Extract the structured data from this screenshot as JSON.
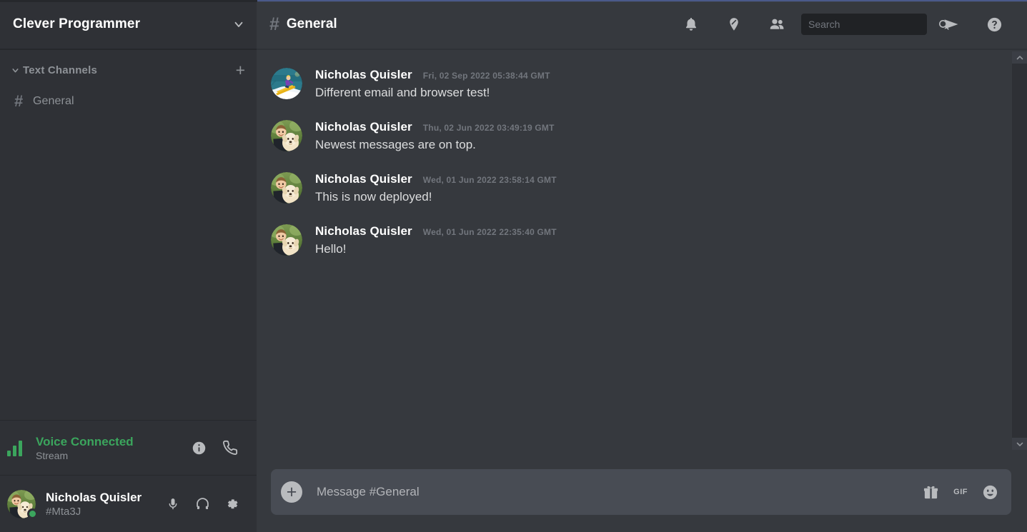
{
  "sidebar": {
    "guild_name": "Clever Programmer",
    "guild_chevron_icon": "chevron-down-icon",
    "category": {
      "label": "Text Channels",
      "chevron_icon": "chevron-down-icon",
      "add_label": "+"
    },
    "channels": [
      {
        "hash": "#",
        "name": "General",
        "active": false
      }
    ],
    "voice": {
      "status": "Voice Connected",
      "subtitle": "Stream",
      "signal_icon": "signal-bars-icon",
      "info_icon": "info-icon",
      "disconnect_icon": "phone-icon",
      "accent_color": "#3ba55d"
    },
    "user": {
      "name": "Nicholas Quisler",
      "tag": "#Mta3J",
      "status": "online",
      "status_color": "#3ba55d",
      "mic_icon": "microphone-icon",
      "headphones_icon": "headphones-icon",
      "settings_icon": "gear-icon"
    }
  },
  "header": {
    "hash": "#",
    "channel_title": "General",
    "icons": [
      {
        "name": "bell-icon"
      },
      {
        "name": "pin-icon"
      },
      {
        "name": "members-icon"
      }
    ],
    "search": {
      "placeholder": "Search",
      "value": "",
      "icon": "search-icon"
    },
    "inbox_icon": "send-icon",
    "help_icon": "help-icon"
  },
  "messages": [
    {
      "author": "Nicholas Quisler",
      "timestamp": "Fri, 02 Sep 2022 05:38:44 GMT",
      "text": "Different email and browser test!",
      "avatar": "ski"
    },
    {
      "author": "Nicholas Quisler",
      "timestamp": "Thu, 02 Jun 2022 03:49:19 GMT",
      "text": "Newest messages are on top.",
      "avatar": "photo"
    },
    {
      "author": "Nicholas Quisler",
      "timestamp": "Wed, 01 Jun 2022 23:58:14 GMT",
      "text": "This is now deployed!",
      "avatar": "photo"
    },
    {
      "author": "Nicholas Quisler",
      "timestamp": "Wed, 01 Jun 2022 22:35:40 GMT",
      "text": "Hello!",
      "avatar": "photo"
    }
  ],
  "composer": {
    "add_label": "+",
    "placeholder": "Message #General",
    "value": "",
    "gift_icon": "gift-icon",
    "gif_label": "GIF",
    "emoji_icon": "emoji-icon"
  },
  "scrollbar": {
    "up_icon": "chevron-up-icon",
    "down_icon": "chevron-down-icon"
  },
  "colors": {
    "sidebar_bg": "#2f3136",
    "main_bg": "#36393e",
    "composer_bg": "#484c54",
    "search_bg": "#202225",
    "text_primary": "#ffffff",
    "text_secondary": "#8e9297",
    "text_body": "#dcddde",
    "green": "#3ba55d"
  }
}
